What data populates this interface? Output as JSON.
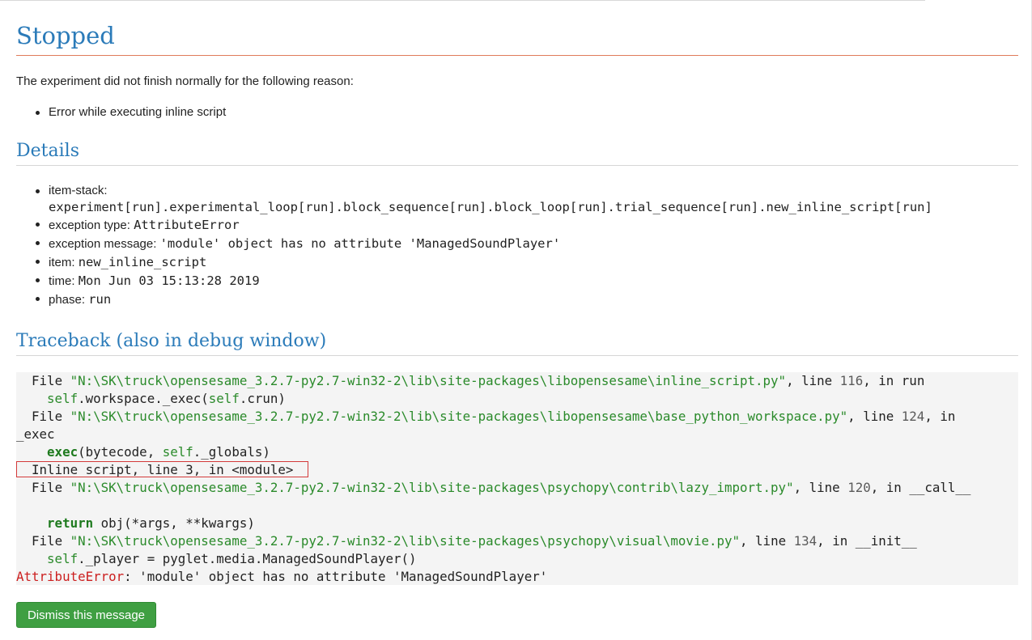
{
  "title": "Stopped",
  "intro": "The experiment did not finish normally for the following reason:",
  "reasons": [
    "Error while executing inline script"
  ],
  "details": {
    "heading": "Details",
    "items": [
      {
        "label": "item-stack:",
        "value": "experiment[run].experimental_loop[run].block_sequence[run].block_loop[run].trial_sequence[run].new_inline_script[run]"
      },
      {
        "label": "exception type:",
        "value": "AttributeError"
      },
      {
        "label": "exception message:",
        "value": "'module' object has no attribute 'ManagedSoundPlayer'"
      },
      {
        "label": "item:",
        "value": "new_inline_script"
      },
      {
        "label": "time:",
        "value": "Mon Jun 03 15:13:28 2019"
      },
      {
        "label": "phase:",
        "value": "run"
      }
    ]
  },
  "traceback": {
    "heading": "Traceback (also in debug window)",
    "frames": [
      {
        "file": "\"N:\\SK\\truck\\opensesame_3.2.7-py2.7-win32-2\\lib\\site-packages\\libopensesame\\inline_script.py\"",
        "line": "116",
        "func": "run",
        "code_self": "self",
        "code_rest": ".workspace._exec(",
        "code_self2": "self",
        "code_end": ".crun)"
      },
      {
        "file": "\"N:\\SK\\truck\\opensesame_3.2.7-py2.7-win32-2\\lib\\site-packages\\libopensesame\\base_python_workspace.py\"",
        "line": "124",
        "func": "_exec",
        "code_kw": "exec",
        "code_mid": "(bytecode, ",
        "code_self": "self",
        "code_end": "._globals)"
      },
      {
        "inline": "Inline script, line 3, in <module>"
      },
      {
        "file": "\"N:\\SK\\truck\\opensesame_3.2.7-py2.7-win32-2\\lib\\site-packages\\psychopy\\contrib\\lazy_import.py\"",
        "line": "120",
        "func": "__call__",
        "code_kw": "return",
        "code_mid": " obj(*args, **kwargs)"
      },
      {
        "file": "\"N:\\SK\\truck\\opensesame_3.2.7-py2.7-win32-2\\lib\\site-packages\\psychopy\\visual\\movie.py\"",
        "line": "134",
        "func": "__init__",
        "code_self": "self",
        "code_end": "._player = pyglet.media.ManagedSoundPlayer()"
      }
    ],
    "error_type": "AttributeError",
    "error_message": ": 'module' object has no attribute 'ManagedSoundPlayer'",
    "words": {
      "file": "File",
      "line": "line",
      "in": "in"
    }
  },
  "dismiss_label": "Dismiss this message",
  "colors": {
    "heading": "#2b7bb9",
    "title_rule": "#e07b5b",
    "button": "#3f9f42",
    "error": "#cc1f1f",
    "string": "#2a8a2a"
  }
}
